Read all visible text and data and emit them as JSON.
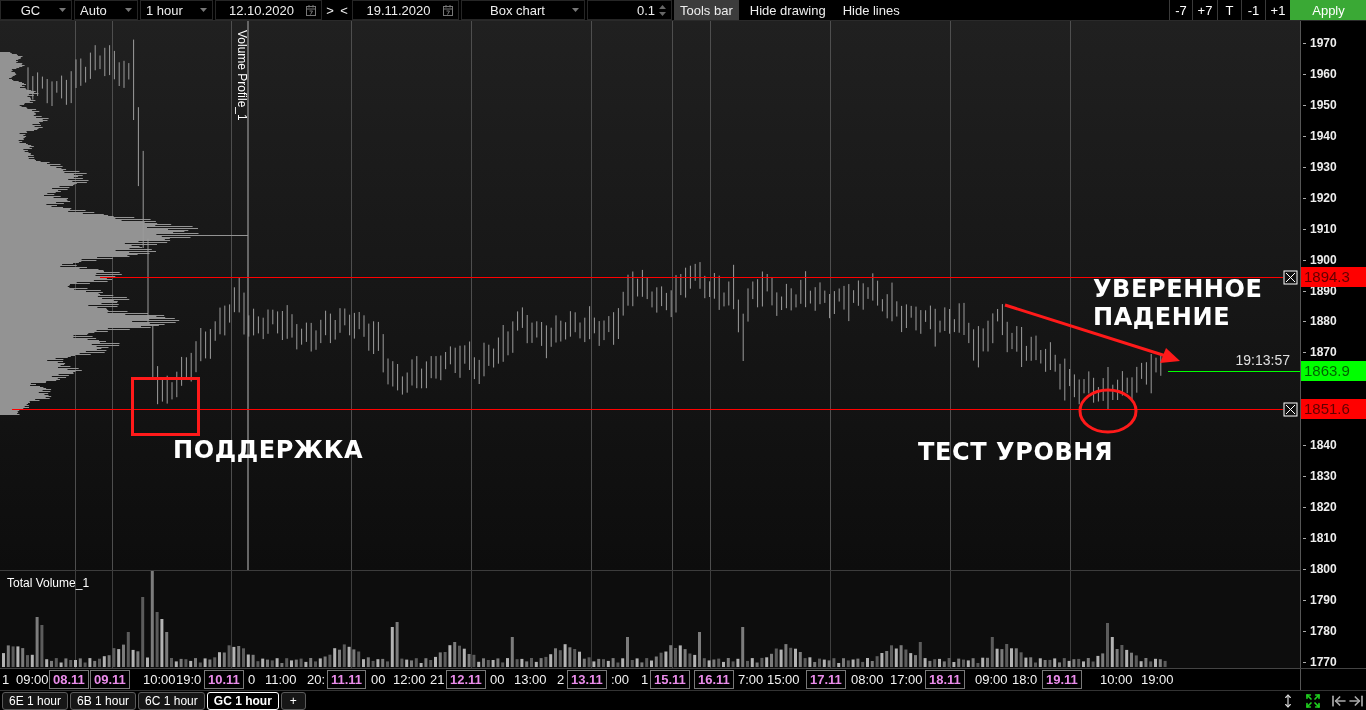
{
  "toolbar": [
    {
      "kind": "dropdown",
      "value": "GC"
    },
    {
      "kind": "dropdown",
      "value": "Auto"
    },
    {
      "kind": "dropdown",
      "value": "1 hour"
    },
    {
      "kind": "date",
      "value": "12.10.2020"
    },
    {
      "kind": "button",
      "label": ">"
    },
    {
      "kind": "button",
      "label": "<"
    },
    {
      "kind": "date",
      "value": "19.11.2020"
    },
    {
      "kind": "dropdown",
      "value": "Box chart"
    },
    {
      "kind": "spinner",
      "value": "0.1"
    },
    {
      "kind": "toggle",
      "label": "Tools bar",
      "on": true
    },
    {
      "kind": "toggle",
      "label": "Hide drawing",
      "on": false
    },
    {
      "kind": "toggle",
      "label": "Hide lines",
      "on": false
    }
  ],
  "toolbar_right": [
    {
      "kind": "button",
      "label": "-7"
    },
    {
      "kind": "button",
      "label": "+7"
    },
    {
      "kind": "button",
      "label": "T"
    },
    {
      "kind": "button",
      "label": "-1"
    },
    {
      "kind": "button",
      "label": "+1"
    },
    {
      "kind": "apply",
      "label": "Apply"
    }
  ],
  "chart": {
    "indicator_label": "Volume Profile_1",
    "annotations": [
      "УВЕРЕННОЕ ПАДЕНИЕ",
      "ПОДДЕРЖКА",
      "ТЕСТ УРОВНЯ"
    ],
    "price_lines": [
      {
        "kind": "level",
        "price": "1894.3",
        "color": "#ff0000"
      },
      {
        "kind": "last",
        "price": "1863.9",
        "time": "19:13:57",
        "color": "#00ff00"
      },
      {
        "kind": "level",
        "price": "1851.6",
        "color": "#ff0000"
      }
    ]
  },
  "volume_pane": {
    "title": "Total Volume_1"
  },
  "price_axis": [
    "1970",
    "1960",
    "1950",
    "1940",
    "1930",
    "1920",
    "1910",
    "1900",
    "1890",
    "1880",
    "1870",
    "1840",
    "1830",
    "1820",
    "1810",
    "1800",
    "1790",
    "1780",
    "1770"
  ],
  "time_axis": [
    {
      "kind": "time",
      "text": "1"
    },
    {
      "kind": "time",
      "text": "09:00"
    },
    {
      "kind": "date",
      "text": "08.11"
    },
    {
      "kind": "date",
      "text": "09.11"
    },
    {
      "kind": "time",
      "text": "10:00"
    },
    {
      "kind": "time",
      "text": "19:0"
    },
    {
      "kind": "date",
      "text": "10.11"
    },
    {
      "kind": "time",
      "text": "0"
    },
    {
      "kind": "time",
      "text": "11:00"
    },
    {
      "kind": "time",
      "text": "20:"
    },
    {
      "kind": "date",
      "text": "11.11"
    },
    {
      "kind": "time",
      "text": "00"
    },
    {
      "kind": "time",
      "text": "12:00"
    },
    {
      "kind": "time",
      "text": "21"
    },
    {
      "kind": "date",
      "text": "12.11"
    },
    {
      "kind": "time",
      "text": "00"
    },
    {
      "kind": "time",
      "text": "13:00"
    },
    {
      "kind": "time",
      "text": "2"
    },
    {
      "kind": "date",
      "text": "13.11"
    },
    {
      "kind": "time",
      "text": ":00"
    },
    {
      "kind": "time",
      "text": "1"
    },
    {
      "kind": "date",
      "text": "15.11"
    },
    {
      "kind": "date",
      "text": "16.11"
    },
    {
      "kind": "time",
      "text": "7:00"
    },
    {
      "kind": "time",
      "text": "15:00"
    },
    {
      "kind": "date",
      "text": "17.11"
    },
    {
      "kind": "time",
      "text": "08:00"
    },
    {
      "kind": "time",
      "text": "17:00"
    },
    {
      "kind": "date",
      "text": "18.11"
    },
    {
      "kind": "time",
      "text": "09:00"
    },
    {
      "kind": "time",
      "text": "18:0"
    },
    {
      "kind": "date",
      "text": "19.11"
    },
    {
      "kind": "time",
      "text": "10:00"
    },
    {
      "kind": "time",
      "text": "19:00"
    }
  ],
  "tabs": [
    {
      "label": "6E 1 hour",
      "selected": false
    },
    {
      "label": "6B 1 hour",
      "selected": false
    },
    {
      "label": "6C 1 hour",
      "selected": false
    },
    {
      "label": "GC 1 hour",
      "selected": true
    }
  ],
  "add_tab": "+"
}
